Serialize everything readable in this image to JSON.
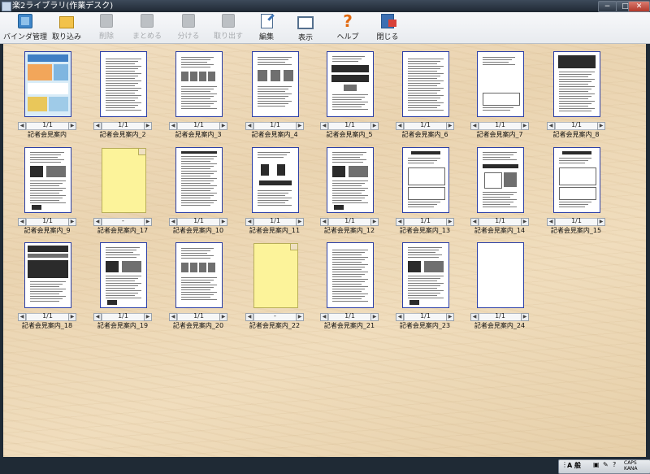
{
  "window": {
    "title": "楽2ライブラリ(作業デスク)",
    "min_label": "−",
    "max_label": "□",
    "close_label": "✕"
  },
  "toolbar": [
    {
      "label": "バインダ管理",
      "icon": "binder-icon",
      "enabled": true
    },
    {
      "label": "取り込み",
      "icon": "import-icon",
      "enabled": true
    },
    {
      "label": "削除",
      "icon": "delete-icon",
      "enabled": false
    },
    {
      "label": "まとめる",
      "icon": "merge-icon",
      "enabled": false
    },
    {
      "label": "分ける",
      "icon": "split-icon",
      "enabled": false
    },
    {
      "label": "取り出す",
      "icon": "extract-icon",
      "enabled": false
    },
    {
      "label": "編集",
      "icon": "edit-icon",
      "enabled": true
    },
    {
      "label": "表示",
      "icon": "view-icon",
      "enabled": true
    },
    {
      "label": "ヘルプ",
      "icon": "help-icon",
      "enabled": true
    },
    {
      "label": "閉じる",
      "icon": "close-book-icon",
      "enabled": true
    }
  ],
  "documents": [
    {
      "name": "記者会見案内",
      "pages": "1/1",
      "type": "colorflyer"
    },
    {
      "name": "記者会見案内_2",
      "pages": "1/1",
      "type": "text"
    },
    {
      "name": "記者会見案内_3",
      "pages": "1/1",
      "type": "table"
    },
    {
      "name": "記者会見案内_4",
      "pages": "1/1",
      "type": "diagram"
    },
    {
      "name": "記者会見案内_5",
      "pages": "1/1",
      "type": "blackbox"
    },
    {
      "name": "記者会見案内_6",
      "pages": "1/1",
      "type": "text"
    },
    {
      "name": "記者会見案内_7",
      "pages": "1/1",
      "type": "sparse"
    },
    {
      "name": "記者会見案内_8",
      "pages": "1/1",
      "type": "blackhead"
    },
    {
      "name": "記者会見案内_9",
      "pages": "1/1",
      "type": "photos"
    },
    {
      "name": "記者会見案内_17",
      "pages": "-",
      "type": "folder"
    },
    {
      "name": "記者会見案内_10",
      "pages": "1/1",
      "type": "dense"
    },
    {
      "name": "記者会見案内_11",
      "pages": "1/1",
      "type": "people"
    },
    {
      "name": "記者会見案内_12",
      "pages": "1/1",
      "type": "photos"
    },
    {
      "name": "記者会見案内_13",
      "pages": "1/1",
      "type": "form"
    },
    {
      "name": "記者会見案内_14",
      "pages": "1/1",
      "type": "map"
    },
    {
      "name": "記者会見案内_15",
      "pages": "1/1",
      "type": "form"
    },
    {
      "name": "記者会見案内_18",
      "pages": "1/1",
      "type": "poster"
    },
    {
      "name": "記者会見案内_19",
      "pages": "1/1",
      "type": "photos"
    },
    {
      "name": "記者会見案内_20",
      "pages": "1/1",
      "type": "table"
    },
    {
      "name": "記者会見案内_22",
      "pages": "-",
      "type": "folder"
    },
    {
      "name": "記者会見案内_21",
      "pages": "1/1",
      "type": "text"
    },
    {
      "name": "記者会見案内_23",
      "pages": "1/1",
      "type": "photos"
    },
    {
      "name": "記者会見案内_24",
      "pages": "1/1",
      "type": "blank"
    }
  ],
  "taskbar": {
    "ime_label": "A 般",
    "caps_label": "CAPS",
    "kana_label": "KANA"
  },
  "colors": {
    "desk": "#ecd8b6",
    "thumb_border": "#2b3fa7",
    "folder": "#fcf39a"
  }
}
